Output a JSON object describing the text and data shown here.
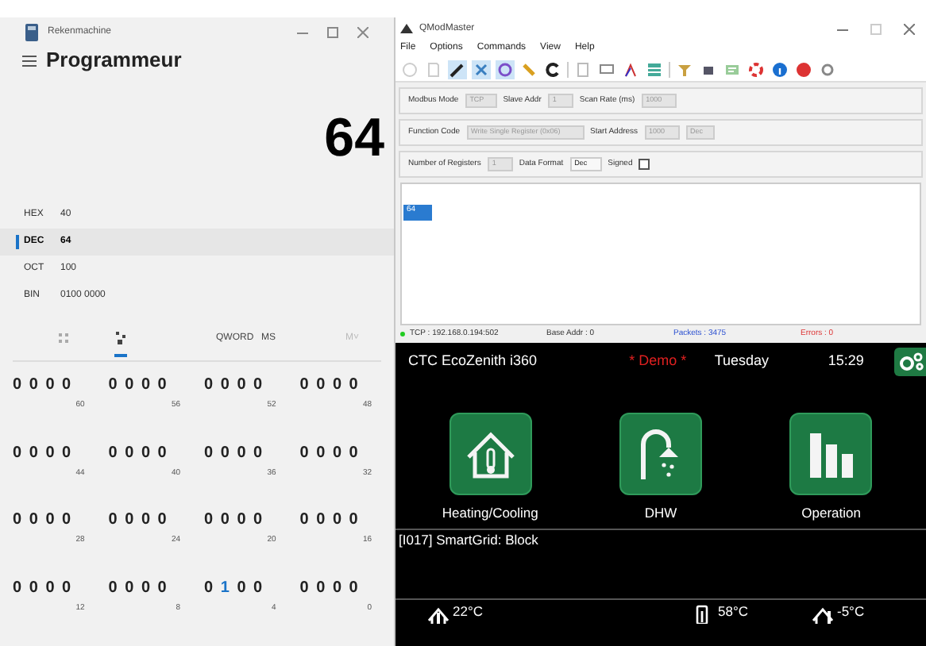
{
  "calculator": {
    "title": "Rekenmachine",
    "mode": "Programmeur",
    "display": "64",
    "radix": [
      {
        "name": "HEX",
        "value": "40",
        "selected": false
      },
      {
        "name": "DEC",
        "value": "64",
        "selected": true
      },
      {
        "name": "OCT",
        "value": "100",
        "selected": false
      },
      {
        "name": "BIN",
        "value": "0100 0000",
        "selected": false
      }
    ],
    "pad_tabs": [
      {
        "kind": "keypad",
        "selected": false
      },
      {
        "kind": "bits",
        "selected": true
      }
    ],
    "word_size": "QWORD",
    "memory": [
      {
        "label": "MS",
        "disabled": false
      },
      {
        "label": "M˅",
        "disabled": true
      }
    ],
    "bit_rows": [
      [
        {
          "bits": "0 0 0 0",
          "label": "60"
        },
        {
          "bits": "0 0 0 0",
          "label": "56"
        },
        {
          "bits": "0 0 0 0",
          "label": "52"
        },
        {
          "bits": "0 0 0 0",
          "label": "48"
        }
      ],
      [
        {
          "bits": "0 0 0 0",
          "label": "44"
        },
        {
          "bits": "0 0 0 0",
          "label": "40"
        },
        {
          "bits": "0 0 0 0",
          "label": "36"
        },
        {
          "bits": "0 0 0 0",
          "label": "32"
        }
      ],
      [
        {
          "bits": "0 0 0 0",
          "label": "28"
        },
        {
          "bits": "0 0 0 0",
          "label": "24"
        },
        {
          "bits": "0 0 0 0",
          "label": "20"
        },
        {
          "bits": "0 0 0 0",
          "label": "16"
        }
      ],
      [
        {
          "bits": "0 0 0 0",
          "label": "12"
        },
        {
          "bits": "0 0 0 0",
          "label": "8"
        },
        {
          "bits": "0 1 0 0",
          "label": "4"
        },
        {
          "bits": "0 0 0 0",
          "label": "0"
        }
      ]
    ]
  },
  "qmodmaster": {
    "title": "QModMaster",
    "menu": [
      "File",
      "Options",
      "Commands",
      "View",
      "Help"
    ],
    "toolbar": [
      {
        "pressed": false
      },
      {
        "pressed": false
      },
      {
        "pressed": true
      },
      {
        "pressed": true
      },
      {
        "pressed": true
      },
      {
        "pressed": false
      },
      {
        "pressed": false
      },
      {
        "pressed": false
      },
      {
        "pressed": false
      },
      {
        "pressed": false
      },
      {
        "pressed": false
      },
      {
        "pressed": false
      },
      {
        "pressed": false
      },
      {
        "pressed": false
      },
      {
        "pressed": false
      },
      {
        "pressed": false
      },
      {
        "pressed": false
      },
      {
        "pressed": false
      }
    ],
    "modbus_mode": {
      "label": "Modbus Mode",
      "value": "TCP"
    },
    "slave_addr": {
      "label": "Slave Addr",
      "value": "1"
    },
    "scan_rate": {
      "label": "Scan Rate (ms)",
      "value": "1000"
    },
    "function_code": {
      "label": "Function Code",
      "value": "Write Single Register (0x06)"
    },
    "start_address": {
      "label": "Start Address",
      "value": "1000",
      "format": "Dec"
    },
    "number_of_registers": {
      "label": "Number of Registers",
      "value": "1"
    },
    "data_format": {
      "label": "Data Format",
      "value": "Dec"
    },
    "signed": {
      "label": "Signed",
      "checked": false
    },
    "registers": [
      {
        "value": "64",
        "selected": true
      }
    ],
    "status_bar": {
      "connection": "TCP : 192.168.0.194:502",
      "base_addr": "Base Addr : 0",
      "packets": "Packets : 3475",
      "errors": "Errors : 0"
    }
  },
  "ctc": {
    "model": "CTC EcoZenith i360",
    "demo": "* Demo *",
    "day": "Tuesday",
    "time": "15:29",
    "tiles": [
      {
        "kind": "house",
        "label": "Heating/Cooling"
      },
      {
        "kind": "shower",
        "label": "DHW"
      },
      {
        "kind": "bars",
        "label": "Operation"
      }
    ],
    "message": "[I017] SmartGrid: Block",
    "readings": [
      {
        "kind": "indoor",
        "value": "22°C"
      },
      {
        "kind": "tank",
        "value": "58°C"
      },
      {
        "kind": "outdoor",
        "value": "-5°C"
      }
    ]
  }
}
